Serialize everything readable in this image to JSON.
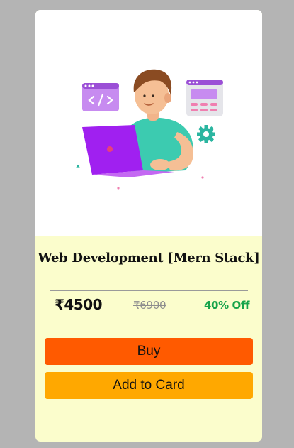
{
  "course": {
    "title": "Web Development [Mern Stack]",
    "price": "₹4500",
    "original_price": "₹6900",
    "discount": "40% Off"
  },
  "actions": {
    "buy_label": "Buy",
    "cart_label": "Add to Card"
  },
  "colors": {
    "page_background": "#b4b4b4",
    "card_body_background": "#fbfdcc",
    "buy_button": "#ff5a00",
    "cart_button": "#ffa800",
    "discount_text": "#16a34a"
  },
  "hero": {
    "illustration": "developer-with-laptop-illustration"
  }
}
